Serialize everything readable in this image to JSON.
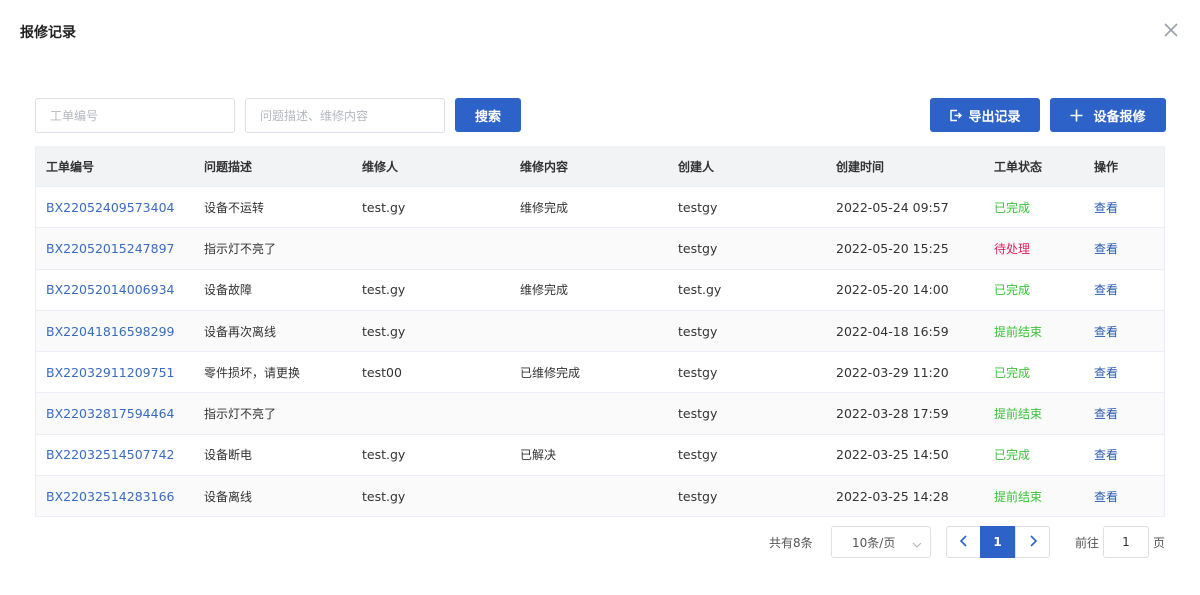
{
  "dialog": {
    "title": "报修记录"
  },
  "filters": {
    "order_no_placeholder": "工单编号",
    "desc_placeholder": "问题描述、维修内容",
    "search_label": "搜索"
  },
  "actions": {
    "export_label": "导出记录",
    "repair_label": "设备报修"
  },
  "table": {
    "headers": [
      "工单编号",
      "问题描述",
      "维修人",
      "维修内容",
      "创建人",
      "创建时间",
      "工单状态",
      "操作"
    ],
    "rows": [
      [
        "BX22052409573404",
        "设备不运转",
        "test.gy",
        "维修完成",
        "testgy",
        "2022-05-24 09:57",
        "已完成",
        "查看"
      ],
      [
        "BX22052015247897",
        "指示灯不亮了",
        "",
        "",
        "testgy",
        "2022-05-20 15:25",
        "待处理",
        "查看"
      ],
      [
        "BX22052014006934",
        "设备故障",
        "test.gy",
        "维修完成",
        "test.gy",
        "2022-05-20 14:00",
        "已完成",
        "查看"
      ],
      [
        "BX22041816598299",
        "设备再次离线",
        "test.gy",
        "",
        "testgy",
        "2022-04-18 16:59",
        "提前结束",
        "查看"
      ],
      [
        "BX22032911209751",
        "零件损坏，请更换",
        "test00",
        "已维修完成",
        "testgy",
        "2022-03-29 11:20",
        "已完成",
        "查看"
      ],
      [
        "BX22032817594464",
        "指示灯不亮了",
        "",
        "",
        "testgy",
        "2022-03-28 17:59",
        "提前结束",
        "查看"
      ],
      [
        "BX22032514507742",
        "设备断电",
        "test.gy",
        "已解决",
        "testgy",
        "2022-03-25 14:50",
        "已完成",
        "查看"
      ],
      [
        "BX22032514283166",
        "设备离线",
        "test.gy",
        "",
        "testgy",
        "2022-03-25 14:28",
        "提前结束",
        "查看"
      ]
    ]
  },
  "status_colors": {
    "已完成": "#3ac23a",
    "待处理": "#e0245e",
    "提前结束": "#3ac23a"
  },
  "pagination": {
    "total_text": "共有8条",
    "page_size": "10条/页",
    "current_page": "1",
    "goto_label": "前往",
    "goto_value": "1",
    "page_suffix": "页"
  },
  "icons": {
    "close": "close-icon",
    "export": "export-icon",
    "add": "plus-icon",
    "prev": "chevron-left-icon",
    "next": "chevron-right-icon",
    "dropdown": "chevron-down-icon"
  }
}
